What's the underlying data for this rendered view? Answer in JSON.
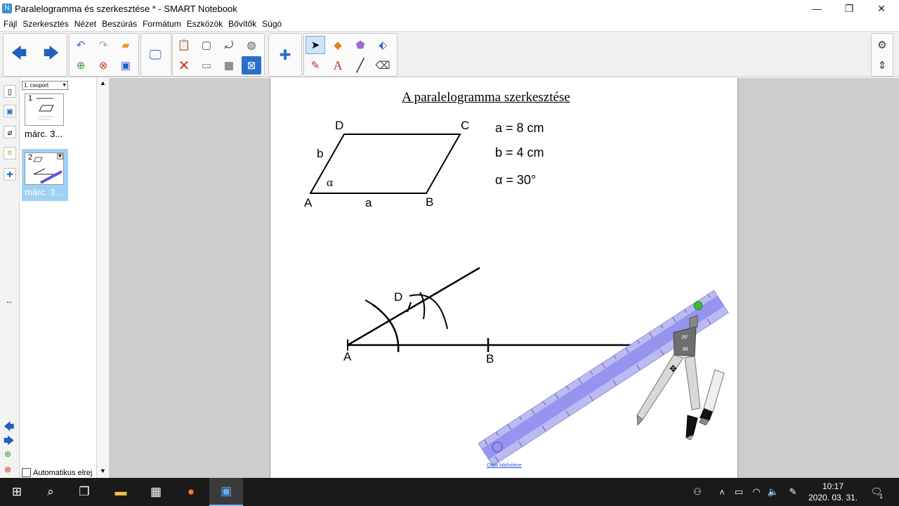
{
  "window": {
    "title": "Paralelogramma és szerkesztése * - SMART Notebook",
    "minimize": "—",
    "restore": "❐",
    "close": "✕"
  },
  "menu": [
    "Fájl",
    "Szerkesztés",
    "Nézet",
    "Beszúrás",
    "Formátum",
    "Eszközök",
    "Bővítők",
    "Súgó"
  ],
  "sorter": {
    "group": "1. csoport",
    "thumbs": [
      {
        "num": "1",
        "label": "márc. 3..."
      },
      {
        "num": "2",
        "label": "márc. 3..."
      }
    ],
    "auto_hide": "Automatikus elrej"
  },
  "page": {
    "title": "A paralelogramma szerkesztése",
    "given": [
      "a = 8 cm",
      "b = 4 cm",
      "α = 30°"
    ],
    "labels": {
      "D": "D",
      "C": "C",
      "A": "A",
      "B": "B",
      "a": "a",
      "b": "b",
      "alpha": "α",
      "A2": "A",
      "B2": "B",
      "D2": "D"
    },
    "ruler_angle": "26°",
    "compass_value": "86",
    "extend_link": "Oldal kibővítése"
  },
  "taskbar": {
    "time": "10:17",
    "date": "2020. 03. 31.",
    "notifications": "1"
  }
}
